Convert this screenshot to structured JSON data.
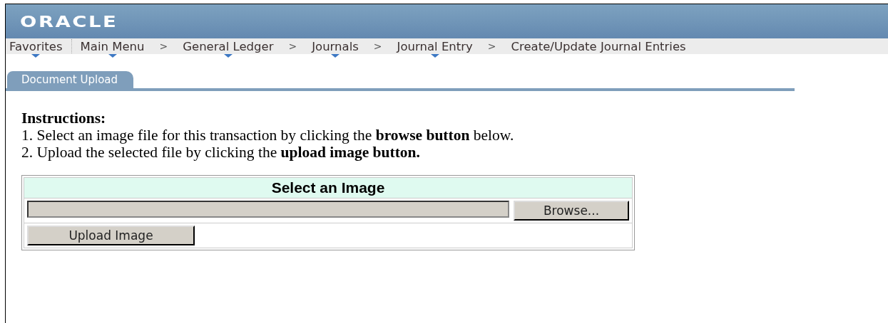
{
  "header": {
    "logo": "ORACLE"
  },
  "breadcrumb": [
    {
      "label": "Favorites",
      "has_menu": true,
      "kind": "favorites"
    },
    {
      "label": "Main Menu",
      "has_menu": true,
      "kind": "link"
    },
    {
      "label": "General Ledger",
      "has_menu": true,
      "kind": "link"
    },
    {
      "label": "Journals",
      "has_menu": true,
      "kind": "link"
    },
    {
      "label": "Journal Entry",
      "has_menu": true,
      "kind": "link"
    },
    {
      "label": "Create/Update Journal Entries",
      "has_menu": false,
      "kind": "link"
    }
  ],
  "separator": ">",
  "tabs": [
    {
      "label": "Document Upload",
      "selected": true
    }
  ],
  "instructions": {
    "heading": "Instructions:",
    "lines": [
      "1. Select an image file for this transaction by clicking the **browse button** below.",
      "2. Upload the selected file by clicking the **upload image button.**"
    ]
  },
  "upload_panel": {
    "title": "Select an Image",
    "browse_button": "Browse...",
    "upload_button": "Upload Image"
  }
}
